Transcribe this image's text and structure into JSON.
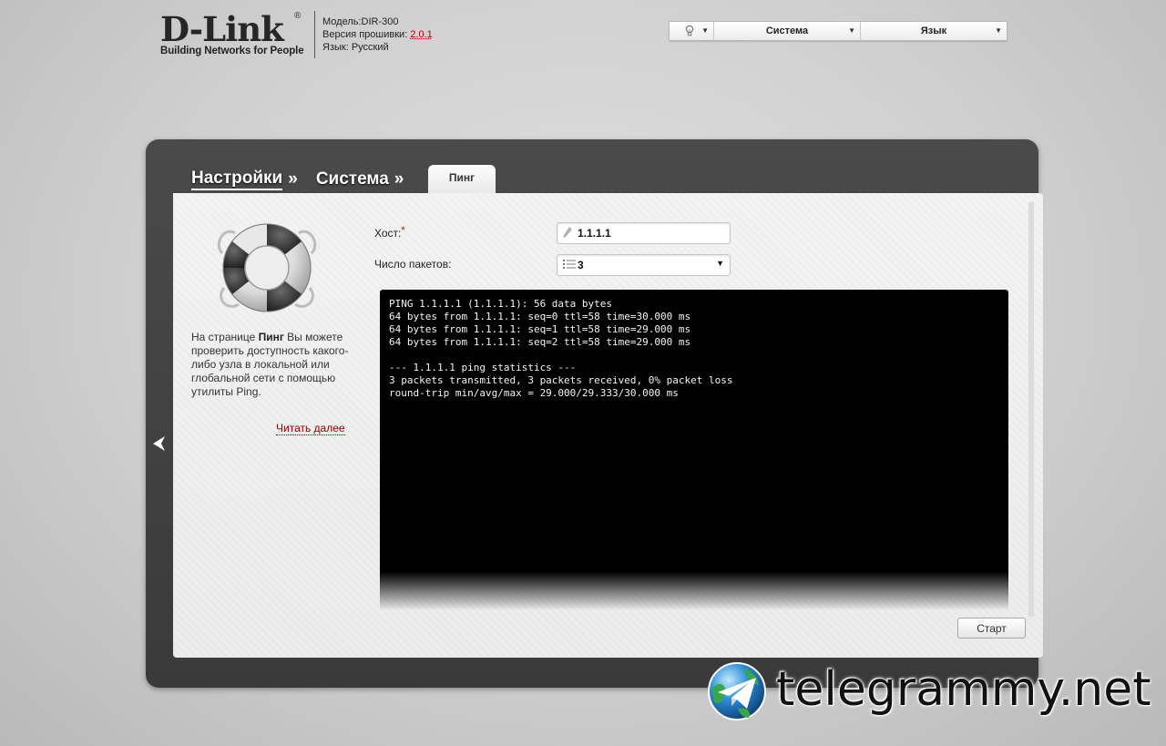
{
  "brand": {
    "logo_text": "D-Link",
    "reg_mark": "®",
    "tagline": "Building Networks for People"
  },
  "device": {
    "model_label": "Модель:",
    "model_value": "DIR-300",
    "firmware_label": "Версия прошивки:",
    "firmware_value": "2.0.1",
    "language_label": "Язык:",
    "language_value": "Русский"
  },
  "top_menu": {
    "system_label": "Система",
    "language_label": "Язык"
  },
  "breadcrumb": {
    "settings": "Настройки",
    "system": "Система",
    "separator": "»",
    "active_tab": "Пинг"
  },
  "help": {
    "text_before": "На странице ",
    "text_bold": "Пинг",
    "text_after": " Вы можете проверить доступность какого-либо узла в локальной или глобальной сети с помощью утилиты Ping.",
    "read_more": "Читать далее"
  },
  "form": {
    "host_label": "Хост:",
    "host_required_mark": "*",
    "host_value": "1.1.1.1",
    "count_label": "Число пакетов:",
    "count_value": "3"
  },
  "console": {
    "lines": [
      "PING 1.1.1.1 (1.1.1.1): 56 data bytes",
      "64 bytes from 1.1.1.1: seq=0 ttl=58 time=30.000 ms",
      "64 bytes from 1.1.1.1: seq=1 ttl=58 time=29.000 ms",
      "64 bytes from 1.1.1.1: seq=2 ttl=58 time=29.000 ms",
      "",
      "--- 1.1.1.1 ping statistics ---",
      "3 packets transmitted, 3 packets received, 0% packet loss",
      "round-trip min/avg/max = 29.000/29.333/30.000 ms"
    ]
  },
  "buttons": {
    "start": "Старт"
  },
  "watermark": {
    "text": "telegrammy.net"
  },
  "icons": {
    "tip": "lightbulb-icon",
    "dropdown": "chevron-down-icon",
    "help": "lifebuoy-icon",
    "back": "arrow-left-icon",
    "edit": "pencil-icon",
    "list": "list-icon",
    "watermark": "telegram-globe-icon"
  },
  "colors": {
    "panel": "#3f3f3f",
    "content": "#efefef",
    "console_bg": "#000000",
    "console_text": "#f4f4f4",
    "link": "#8b0000",
    "required": "#c00000"
  }
}
